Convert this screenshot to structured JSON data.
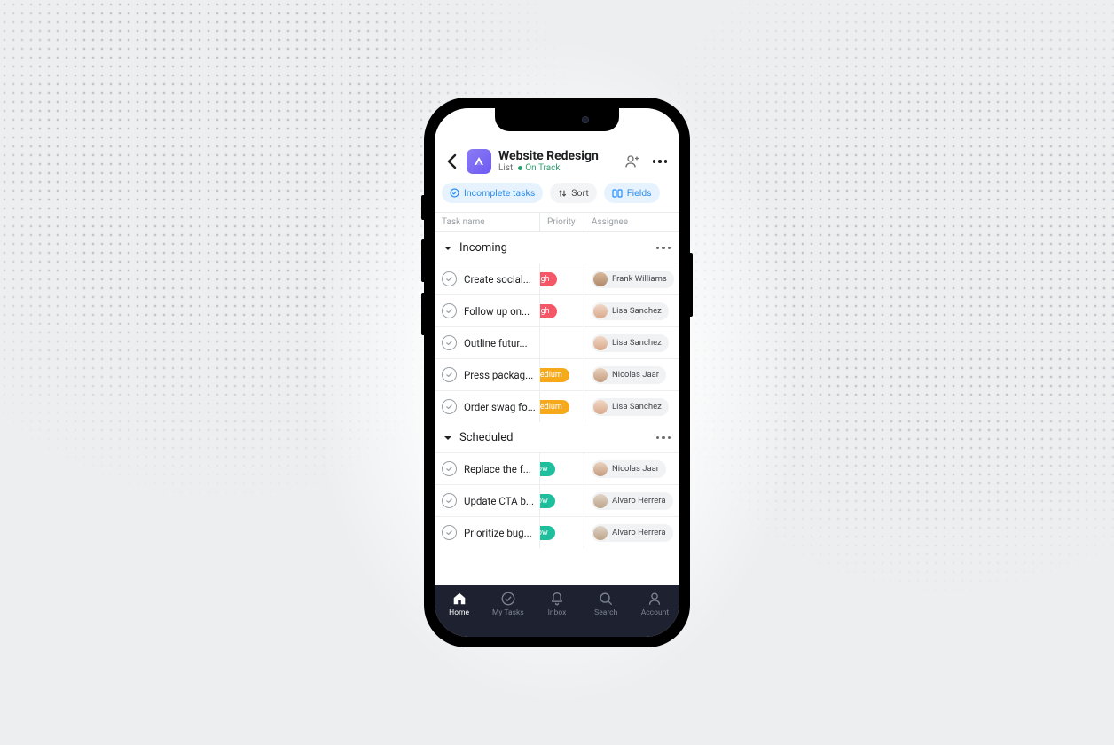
{
  "header": {
    "title": "Website Redesign",
    "view_label": "List",
    "status_label": "On Track"
  },
  "chips": {
    "incomplete": "Incomplete tasks",
    "sort": "Sort",
    "fields": "Fields"
  },
  "columns": {
    "name": "Task name",
    "priority": "Priority",
    "assignee": "Assignee"
  },
  "sections": [
    {
      "name": "Incoming",
      "tasks": [
        {
          "name": "Create social...",
          "priority": "High",
          "priority_level": "high",
          "assignee": "Frank Williams",
          "avatar": "av-a"
        },
        {
          "name": "Follow up on...",
          "priority": "High",
          "priority_level": "high",
          "assignee": "Lisa Sanchez",
          "avatar": "av-b"
        },
        {
          "name": "Outline futur...",
          "priority": "",
          "priority_level": "",
          "assignee": "Lisa Sanchez",
          "avatar": "av-b"
        },
        {
          "name": "Press packag...",
          "priority": "Medium",
          "priority_level": "medium",
          "assignee": "Nicolas Jaar",
          "avatar": "av-c"
        },
        {
          "name": "Order swag fo...",
          "priority": "Medium",
          "priority_level": "medium",
          "assignee": "Lisa Sanchez",
          "avatar": "av-b"
        }
      ]
    },
    {
      "name": "Scheduled",
      "tasks": [
        {
          "name": "Replace the f...",
          "priority": "Low",
          "priority_level": "low",
          "assignee": "Nicolas Jaar",
          "avatar": "av-c"
        },
        {
          "name": "Update CTA b...",
          "priority": "Low",
          "priority_level": "low",
          "assignee": "Alvaro Herrera",
          "avatar": "av-d"
        },
        {
          "name": "Prioritize bug...",
          "priority": "Low",
          "priority_level": "low",
          "assignee": "Alvaro Herrera",
          "avatar": "av-d"
        }
      ]
    }
  ],
  "tabs": {
    "home": "Home",
    "mytasks": "My Tasks",
    "inbox": "Inbox",
    "search": "Search",
    "account": "Account"
  },
  "colors": {
    "accent_blue": "#2a8cf0",
    "status_green": "#2f9e6f",
    "priority_high": "#f55766",
    "priority_medium": "#f6a91b",
    "priority_low": "#1fbf9d"
  }
}
